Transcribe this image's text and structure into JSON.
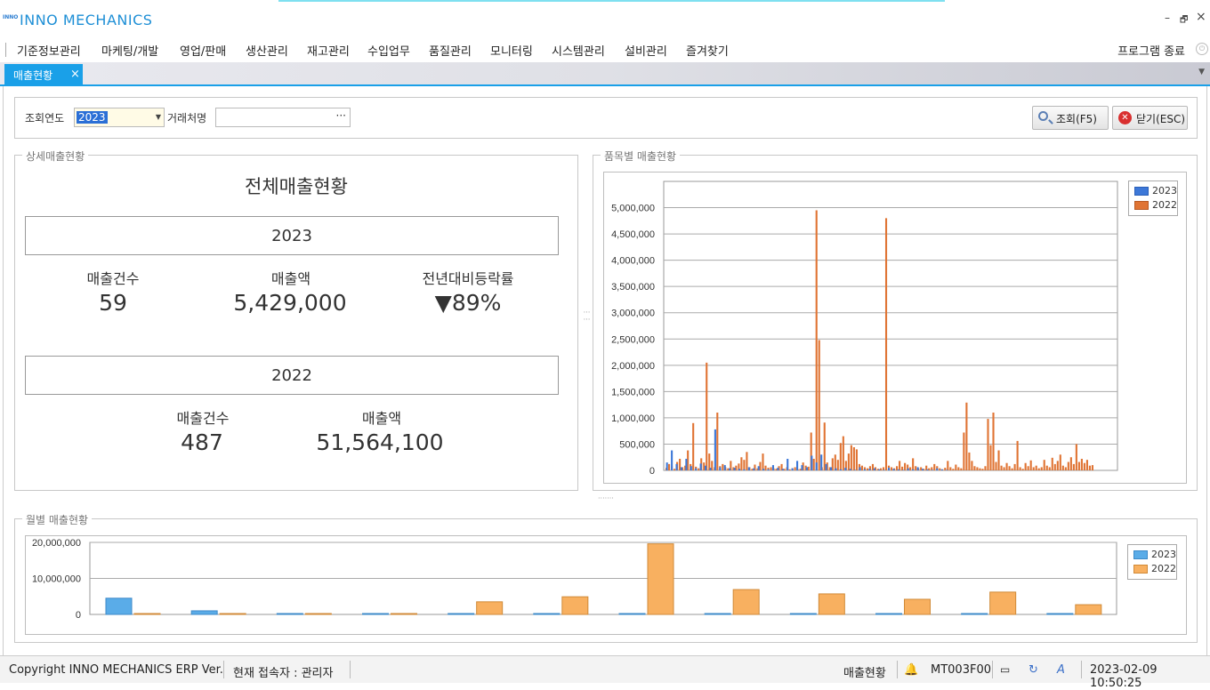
{
  "app": {
    "title": "INNO MECHANICS",
    "logo_text": "INNO"
  },
  "window_controls": {
    "minimize": "–",
    "restore": "🗗",
    "close": "×"
  },
  "menu": {
    "items": [
      "기준정보관리",
      "마케팅/개발",
      "영업/판매",
      "생산관리",
      "재고관리",
      "수입업무",
      "품질관리",
      "모니터링",
      "시스템관리",
      "설비관리",
      "즐겨찾기"
    ],
    "exit_label": "프로그램 종료"
  },
  "tabs": [
    {
      "label": "매출현황",
      "close": "×"
    }
  ],
  "search": {
    "year_label": "조회연도",
    "year_value": "2023",
    "partner_label": "거래처명",
    "partner_value": "",
    "partner_button": "···",
    "query_button": "조회(F5)",
    "close_button": "닫기(ESC)"
  },
  "detail": {
    "group_title": "상세매출현황",
    "title": "전체매출현황",
    "current": {
      "year": "2023",
      "count_label": "매출건수",
      "count": "59",
      "amount_label": "매출액",
      "amount": "5,429,000",
      "change_label": "전년대비등락률",
      "change": "▼89%"
    },
    "previous": {
      "year": "2022",
      "count_label": "매출건수",
      "count": "487",
      "amount_label": "매출액",
      "amount": "51,564,100"
    }
  },
  "item_chart_title": "품목별 매출현황",
  "monthly_chart_title": "월별 매출현황",
  "colors": {
    "accent": "#1aa0e8",
    "s2023_item": "#3d78d8",
    "s2022_item": "#e07434",
    "s2023_month": "#5aace8",
    "s2022_month": "#f8b060"
  },
  "chart_data": [
    {
      "type": "bar",
      "yticks": [
        "5,000,000",
        "4,500,000",
        "4,000,000",
        "3,500,000",
        "3,000,000",
        "2,500,000",
        "2,000,000",
        "1,500,000",
        "1,000,000",
        "500,000",
        "0"
      ],
      "ylim": [
        0,
        5500000
      ],
      "grid": true,
      "legend_position": "top-right",
      "series": [
        {
          "name": "2023",
          "values": [
            150000,
            380000,
            120000,
            60000,
            220000,
            80000,
            40000,
            130000,
            90000,
            50000,
            780000,
            60000,
            100000,
            40000,
            50000,
            30000,
            20000,
            60000,
            40000,
            80000,
            30000,
            20000,
            100000,
            50000,
            30000,
            220000,
            40000,
            180000,
            100000,
            60000,
            280000,
            150000,
            300000,
            120000,
            60000,
            40000,
            20000,
            50000,
            30000,
            10000,
            60000,
            20000,
            30000,
            40000,
            20000,
            10000,
            50000,
            30000,
            20000,
            10000,
            40000,
            20000,
            60000,
            30000,
            20000,
            10000,
            40000,
            20000,
            10000
          ]
        },
        {
          "name": "2022",
          "values": [
            50000,
            120000,
            80000,
            30000,
            160000,
            220000,
            60000,
            90000,
            380000,
            120000,
            900000,
            70000,
            40000,
            230000,
            150000,
            2050000,
            320000,
            180000,
            60000,
            1100000,
            80000,
            120000,
            60000,
            40000,
            180000,
            60000,
            90000,
            130000,
            250000,
            200000,
            350000,
            60000,
            30000,
            110000,
            40000,
            160000,
            320000,
            90000,
            50000,
            60000,
            40000,
            30000,
            80000,
            120000,
            30000,
            60000,
            20000,
            40000,
            60000,
            20000,
            30000,
            150000,
            90000,
            70000,
            720000,
            220000,
            4950000,
            2480000,
            60000,
            910000,
            150000,
            60000,
            230000,
            300000,
            200000,
            520000,
            650000,
            180000,
            320000,
            480000,
            440000,
            400000,
            120000,
            90000,
            60000,
            40000,
            80000,
            120000,
            60000,
            30000,
            40000,
            60000,
            4800000,
            90000,
            60000,
            40000,
            80000,
            180000,
            70000,
            140000,
            110000,
            60000,
            230000,
            80000,
            40000,
            60000,
            30000,
            90000,
            40000,
            60000,
            120000,
            80000,
            40000,
            20000,
            50000,
            180000,
            60000,
            30000,
            110000,
            60000,
            40000,
            720000,
            1290000,
            340000,
            180000,
            80000,
            60000,
            40000,
            30000,
            80000,
            980000,
            480000,
            1100000,
            160000,
            380000,
            90000,
            60000,
            140000,
            80000,
            40000,
            120000,
            560000,
            60000,
            30000,
            140000,
            80000,
            190000,
            60000,
            90000,
            40000,
            60000,
            200000,
            90000,
            60000,
            240000,
            120000,
            180000,
            300000,
            90000,
            60000,
            160000,
            250000,
            120000,
            500000,
            160000,
            220000,
            140000,
            200000,
            90000,
            100000
          ]
        }
      ]
    },
    {
      "type": "bar",
      "yticks": [
        "20,000,000",
        "10,000,000",
        "0"
      ],
      "ylim": [
        0,
        20000000
      ],
      "grid": true,
      "legend_position": "top-right",
      "series": [
        {
          "name": "2023",
          "values": [
            4500000,
            1000000,
            0,
            0,
            0,
            0,
            0,
            0,
            0,
            0,
            0,
            0
          ]
        },
        {
          "name": "2022",
          "values": [
            0,
            0,
            0,
            0,
            3500000,
            4900000,
            19600000,
            6900000,
            5700000,
            4200000,
            6200000,
            2700000
          ]
        }
      ]
    }
  ],
  "status": {
    "copyright": "Copyright INNO MECHANICS ERP Ver.",
    "user": "현재 접속자 : 관리자",
    "screen": "매출현황",
    "code": "MT003F00",
    "datetime": "2023-02-09 10:50:25"
  }
}
